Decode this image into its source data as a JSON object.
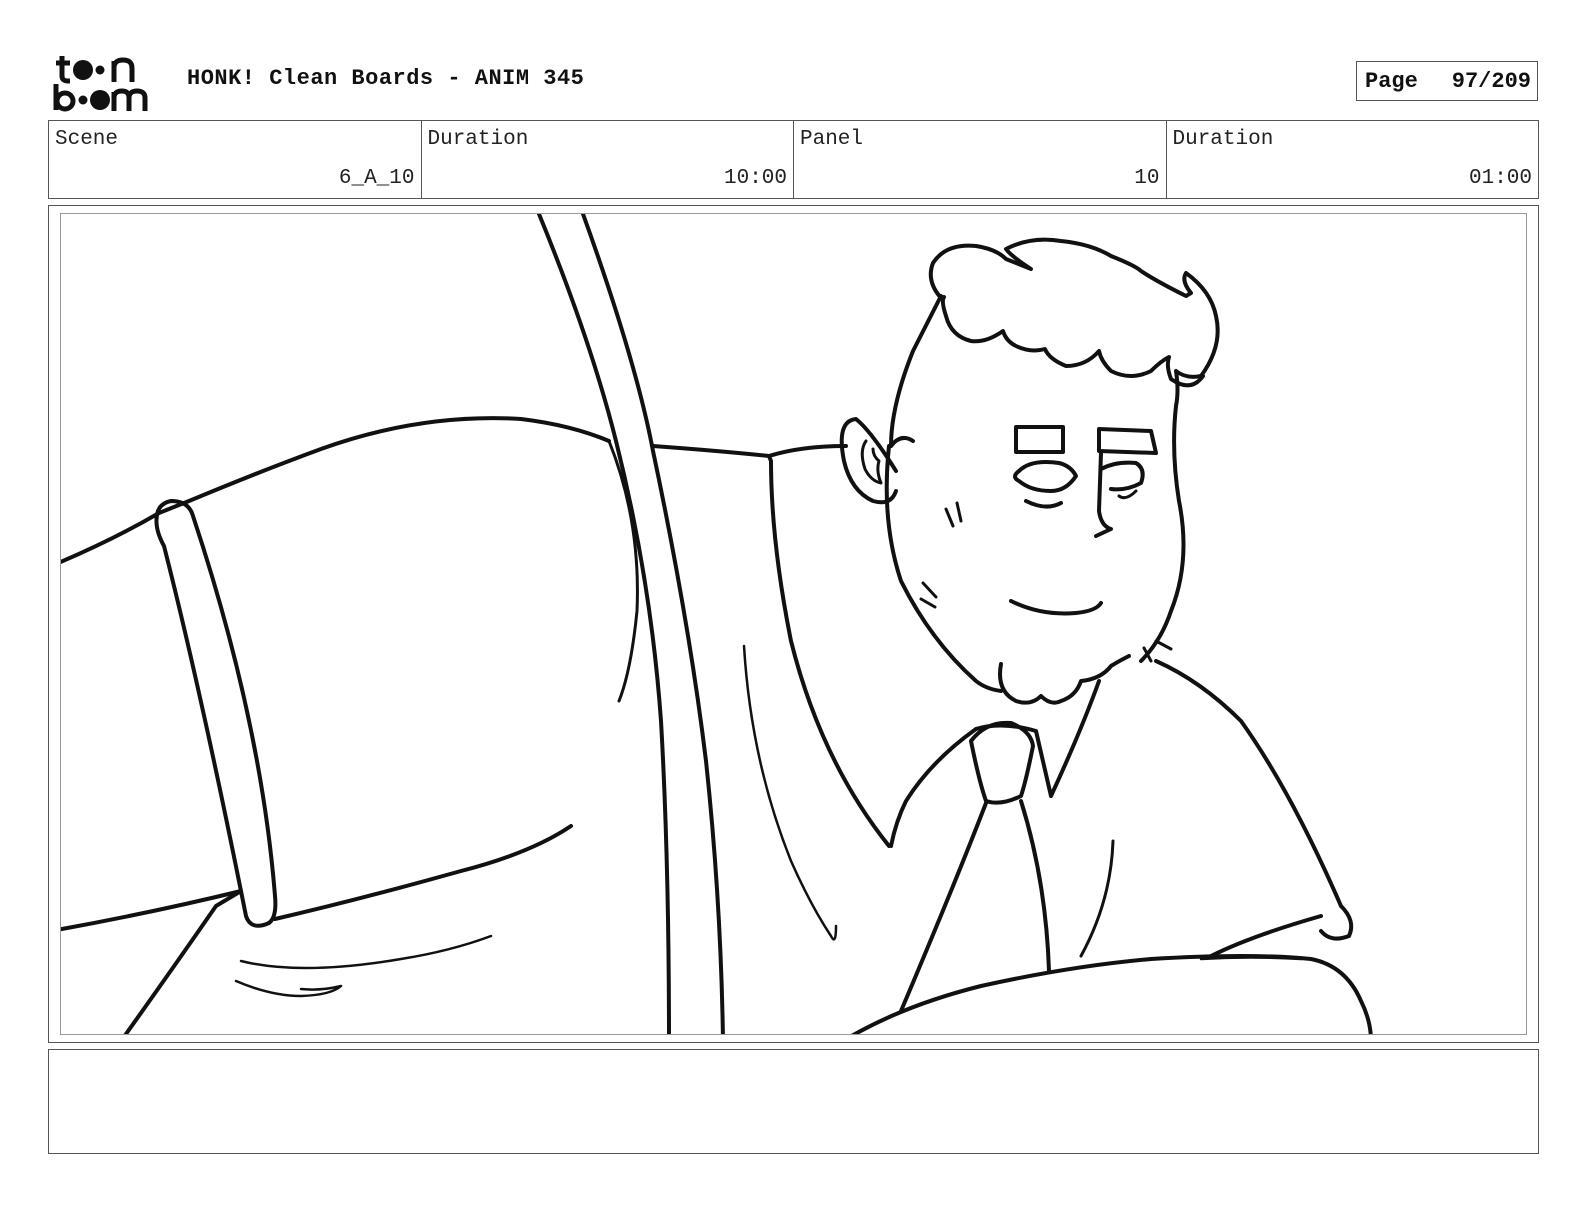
{
  "header": {
    "logo_text": "toon boom",
    "title": "HONK! Clean Boards - ANIM 345",
    "page_label": "Page",
    "page_value": "97/209"
  },
  "info": {
    "scene_label": "Scene",
    "scene_value": "6_A_10",
    "scene_duration_label": "Duration",
    "scene_duration_value": "10:00",
    "panel_label": "Panel",
    "panel_value": "10",
    "panel_duration_label": "Duration",
    "panel_duration_value": "01:00"
  },
  "notes": {
    "text": ""
  }
}
